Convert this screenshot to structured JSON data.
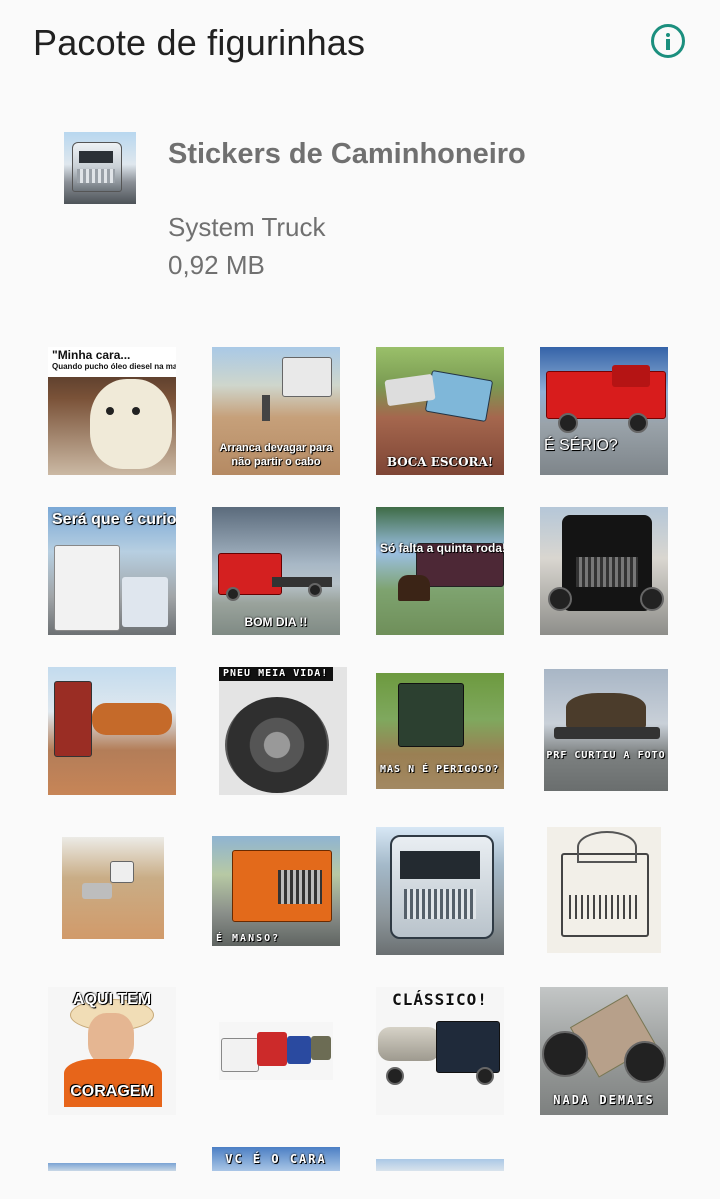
{
  "appbar": {
    "title": "Pacote de figurinhas",
    "info_icon": "info-icon"
  },
  "pack": {
    "name": "Stickers de Caminhoneiro",
    "publisher": "System Truck",
    "size": "0,92 MB",
    "icon": "truck-tray-icon"
  },
  "stickers": [
    {
      "id": "cat-meme",
      "top": "\"Minha cara...",
      "mid": "Quando pucho óleo diesel na mangueira!!\"",
      "bottom": ""
    },
    {
      "id": "boy-bike",
      "top": "",
      "bottom": "Arranca devagar para\nnão partir o cabo"
    },
    {
      "id": "stuck-truck",
      "top": "",
      "bottom": "BOCA ESCORA!"
    },
    {
      "id": "red-truck",
      "top": "",
      "bottom": "É SÉRIO?"
    },
    {
      "id": "curious",
      "top": "Será que é curioso ?",
      "bottom": ""
    },
    {
      "id": "bom-dia",
      "top": "",
      "bottom": "BOM DIA !!"
    },
    {
      "id": "horse",
      "top": "Só falta a quinta roda!",
      "bottom": ""
    },
    {
      "id": "black-truck",
      "top": "",
      "bottom": ""
    },
    {
      "id": "road-train",
      "top": "",
      "bottom": ""
    },
    {
      "id": "tire",
      "top": "PNEU MEIA VIDA!",
      "bottom": ""
    },
    {
      "id": "mud-truck",
      "top": "",
      "bottom": "MAS N É PERIGOSO?"
    },
    {
      "id": "prf",
      "top": "",
      "bottom": "PRF CURTIU A FOTO"
    },
    {
      "id": "dust-road",
      "top": "",
      "bottom": ""
    },
    {
      "id": "orange-truck",
      "top": "",
      "bottom": "É MANSO?"
    },
    {
      "id": "custom-truck",
      "top": "",
      "bottom": ""
    },
    {
      "id": "sketch-truck",
      "top": "",
      "bottom": ""
    },
    {
      "id": "coragem",
      "top": "AQUI TEM",
      "bottom": "CORAGEM"
    },
    {
      "id": "convoy",
      "top": "",
      "bottom": ""
    },
    {
      "id": "classico",
      "top": "CLÁSSICO!",
      "bottom": ""
    },
    {
      "id": "nada-demais",
      "top": "",
      "bottom": "NADA DEMAIS"
    },
    {
      "id": "partial-1",
      "top": "",
      "bottom": ""
    },
    {
      "id": "partial-2",
      "top": "VC É O CARA",
      "bottom": ""
    },
    {
      "id": "partial-3",
      "top": "",
      "bottom": ""
    }
  ]
}
